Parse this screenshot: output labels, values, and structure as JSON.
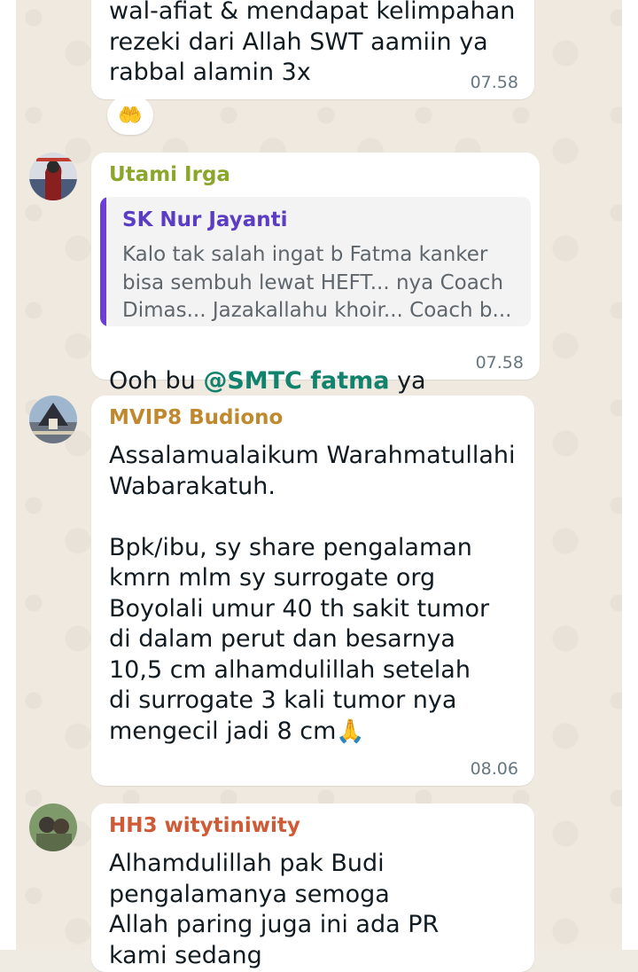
{
  "messages": [
    {
      "text": "wal-afiat & mendapat kelimpahan\nrezeki dari Allah SWT aamiin ya\nrabbal alamin 3x",
      "time": "07.58",
      "reaction": "🤲"
    },
    {
      "sender": "Utami Irga",
      "sender_color": "#8aa72c",
      "quote_author": "SK Nur Jayanti",
      "quote_text": "Kalo tak salah ingat b Fatma kanker\nbisa sembuh lewat HEFT... nya Coach\nDimas... Jazakallahu khoir... Coach b...",
      "text_before": "Ooh bu ",
      "mention": "@SMTC fatma",
      "text_after": " ya",
      "time": "07.58"
    },
    {
      "sender": "MVIP8 Budiono",
      "sender_color": "#c1892f",
      "text": "Assalamualaikum Warahmatullahi\nWabarakatuh.\n\nBpk/ibu, sy share pengalaman\nkmrn mlm sy surrogate org\nBoyolali umur 40 th sakit tumor\ndi dalam perut dan besarnya\n10,5 cm alhamdulillah setelah\ndi surrogate 3 kali tumor nya\nmengecil jadi 8 cm",
      "emoji": "🙏",
      "time": "08.06"
    },
    {
      "sender": "HH3 witytiniwity",
      "sender_color": "#cf5a35",
      "text": "Alhamdulillah pak Budi\npengalamanya semoga\nAllah paring juga ini ada PR\nkami sedang"
    }
  ],
  "colors": {
    "wallpaper": "#efe9df",
    "bubble": "#ffffff",
    "quote_bar": "#6b3fd6",
    "mention": "#11826c",
    "timestamp": "#667781"
  }
}
